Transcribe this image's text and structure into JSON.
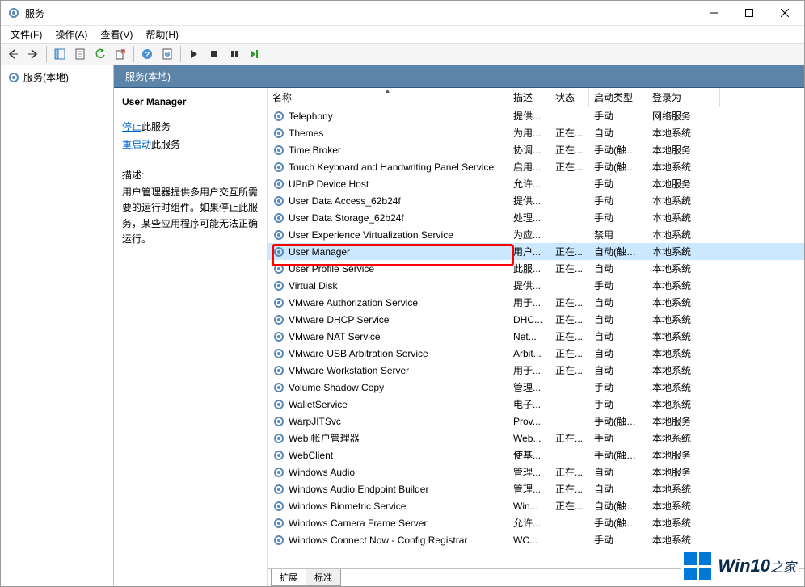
{
  "window": {
    "title": "服务"
  },
  "menus": [
    "文件(F)",
    "操作(A)",
    "查看(V)",
    "帮助(H)"
  ],
  "nav": {
    "root": "服务(本地)"
  },
  "mainHeader": "服务(本地)",
  "detail": {
    "serviceName": "User Manager",
    "stopLink": "停止",
    "stopSuffix": "此服务",
    "restartLink": "重启动",
    "restartSuffix": "此服务",
    "descLabel": "描述:",
    "descText": "用户管理器提供多用户交互所需要的运行时组件。如果停止此服务，某些应用程序可能无法正确运行。"
  },
  "columns": {
    "name": "名称",
    "desc": "描述",
    "state": "状态",
    "start": "启动类型",
    "logon": "登录为"
  },
  "tabs": {
    "extended": "扩展",
    "standard": "标准"
  },
  "rows": [
    {
      "name": "Telephony",
      "desc": "提供...",
      "state": "",
      "start": "手动",
      "logon": "网络服务"
    },
    {
      "name": "Themes",
      "desc": "为用...",
      "state": "正在...",
      "start": "自动",
      "logon": "本地系统"
    },
    {
      "name": "Time Broker",
      "desc": "协调...",
      "state": "正在...",
      "start": "手动(触发...",
      "logon": "本地服务"
    },
    {
      "name": "Touch Keyboard and Handwriting Panel Service",
      "desc": "启用...",
      "state": "正在...",
      "start": "手动(触发...",
      "logon": "本地系统"
    },
    {
      "name": "UPnP Device Host",
      "desc": "允许...",
      "state": "",
      "start": "手动",
      "logon": "本地服务"
    },
    {
      "name": "User Data Access_62b24f",
      "desc": "提供...",
      "state": "",
      "start": "手动",
      "logon": "本地系统"
    },
    {
      "name": "User Data Storage_62b24f",
      "desc": "处理...",
      "state": "",
      "start": "手动",
      "logon": "本地系统"
    },
    {
      "name": "User Experience Virtualization Service",
      "desc": "为应...",
      "state": "",
      "start": "禁用",
      "logon": "本地系统"
    },
    {
      "name": "User Manager",
      "desc": "用户...",
      "state": "正在...",
      "start": "自动(触发...",
      "logon": "本地系统",
      "sel": true
    },
    {
      "name": "User Profile Service",
      "desc": "此服...",
      "state": "正在...",
      "start": "自动",
      "logon": "本地系统"
    },
    {
      "name": "Virtual Disk",
      "desc": "提供...",
      "state": "",
      "start": "手动",
      "logon": "本地系统"
    },
    {
      "name": "VMware Authorization Service",
      "desc": "用于...",
      "state": "正在...",
      "start": "自动",
      "logon": "本地系统"
    },
    {
      "name": "VMware DHCP Service",
      "desc": "DHC...",
      "state": "正在...",
      "start": "自动",
      "logon": "本地系统"
    },
    {
      "name": "VMware NAT Service",
      "desc": "Net...",
      "state": "正在...",
      "start": "自动",
      "logon": "本地系统"
    },
    {
      "name": "VMware USB Arbitration Service",
      "desc": "Arbit...",
      "state": "正在...",
      "start": "自动",
      "logon": "本地系统"
    },
    {
      "name": "VMware Workstation Server",
      "desc": "用于...",
      "state": "正在...",
      "start": "自动",
      "logon": "本地系统"
    },
    {
      "name": "Volume Shadow Copy",
      "desc": "管理...",
      "state": "",
      "start": "手动",
      "logon": "本地系统"
    },
    {
      "name": "WalletService",
      "desc": "电子...",
      "state": "",
      "start": "手动",
      "logon": "本地系统"
    },
    {
      "name": "WarpJITSvc",
      "desc": "Prov...",
      "state": "",
      "start": "手动(触发...",
      "logon": "本地服务"
    },
    {
      "name": "Web 帐户管理器",
      "desc": "Web...",
      "state": "正在...",
      "start": "手动",
      "logon": "本地系统"
    },
    {
      "name": "WebClient",
      "desc": "使基...",
      "state": "",
      "start": "手动(触发...",
      "logon": "本地服务"
    },
    {
      "name": "Windows Audio",
      "desc": "管理...",
      "state": "正在...",
      "start": "自动",
      "logon": "本地服务"
    },
    {
      "name": "Windows Audio Endpoint Builder",
      "desc": "管理...",
      "state": "正在...",
      "start": "自动",
      "logon": "本地系统"
    },
    {
      "name": "Windows Biometric Service",
      "desc": "Win...",
      "state": "正在...",
      "start": "自动(触发...",
      "logon": "本地系统"
    },
    {
      "name": "Windows Camera Frame Server",
      "desc": "允许...",
      "state": "",
      "start": "手动(触发...",
      "logon": "本地系统"
    },
    {
      "name": "Windows Connect Now - Config Registrar",
      "desc": "WC...",
      "state": "",
      "start": "手动",
      "logon": "本地系统"
    }
  ],
  "watermark": {
    "brand": "Win10",
    "suffix": "之家"
  }
}
